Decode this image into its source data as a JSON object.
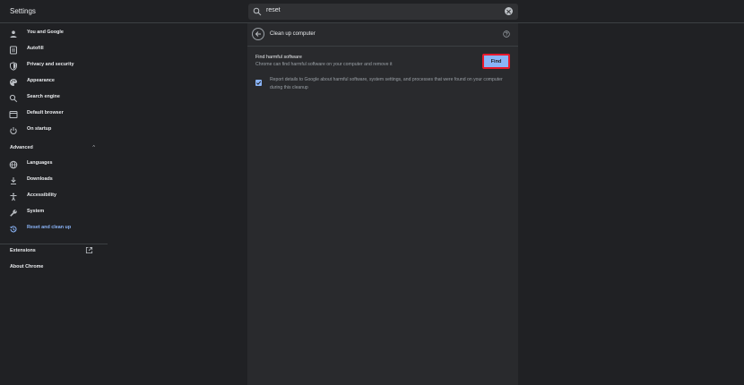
{
  "header": {
    "title": "Settings"
  },
  "search": {
    "value": "reset"
  },
  "sidebar": {
    "items": [
      {
        "label": "You and Google",
        "icon": "person-icon"
      },
      {
        "label": "Autofill",
        "icon": "autofill-icon"
      },
      {
        "label": "Privacy and security",
        "icon": "shield-icon"
      },
      {
        "label": "Appearance",
        "icon": "palette-icon"
      },
      {
        "label": "Search engine",
        "icon": "search-icon"
      },
      {
        "label": "Default browser",
        "icon": "browser-icon"
      },
      {
        "label": "On startup",
        "icon": "power-icon"
      }
    ],
    "advanced_label": "Advanced",
    "advanced_items": [
      {
        "label": "Languages",
        "icon": "globe-icon"
      },
      {
        "label": "Downloads",
        "icon": "download-icon"
      },
      {
        "label": "Accessibility",
        "icon": "accessibility-icon"
      },
      {
        "label": "System",
        "icon": "wrench-icon"
      },
      {
        "label": "Reset and clean up",
        "icon": "restore-icon",
        "active": true
      }
    ],
    "extensions_label": "Extensions",
    "about_label": "About Chrome"
  },
  "main": {
    "page_title": "Clean up computer",
    "find_title": "Find harmful software",
    "find_subtitle": "Chrome can find harmful software on your computer and remove it",
    "find_button": "Find",
    "report_text": "Report details to Google about harmful software, system settings, and processes that were found on your computer during this cleanup",
    "report_checked": true
  },
  "colors": {
    "background": "#202124",
    "card": "#292a2d",
    "accent": "#8ab4f8",
    "highlight_border": "#e8192c"
  }
}
